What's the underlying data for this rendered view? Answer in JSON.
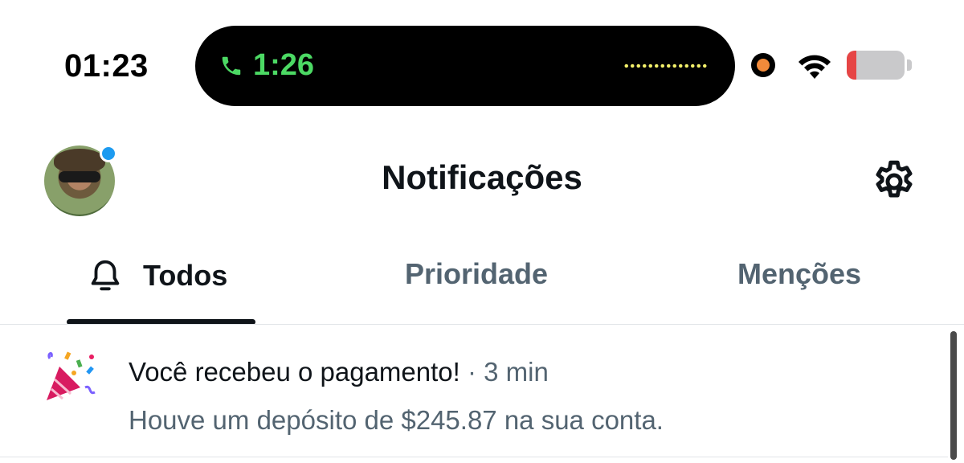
{
  "status_bar": {
    "time": "01:23",
    "call_time": "1:26",
    "icons": [
      "phone-icon",
      "recording-dot-icon",
      "wifi-icon",
      "battery-icon"
    ],
    "battery_level": 0.16
  },
  "header": {
    "title": "Notificações",
    "avatar_badge": true
  },
  "tabs": [
    {
      "label": "Todos",
      "active": true,
      "icon": "bell-icon"
    },
    {
      "label": "Prioridade",
      "active": false
    },
    {
      "label": "Menções",
      "active": false
    }
  ],
  "notifications": [
    {
      "icon": "party-popper-icon",
      "title": "Você recebeu o pagamento!",
      "separator": " · ",
      "time": "3 min",
      "body": "Houve um depósito de $245.87 na sua conta."
    }
  ],
  "colors": {
    "accent": "#1d9bf0",
    "text_primary": "#0f1419",
    "text_secondary": "#536471",
    "call_green": "#4cd964",
    "battery_low": "#e64545"
  }
}
